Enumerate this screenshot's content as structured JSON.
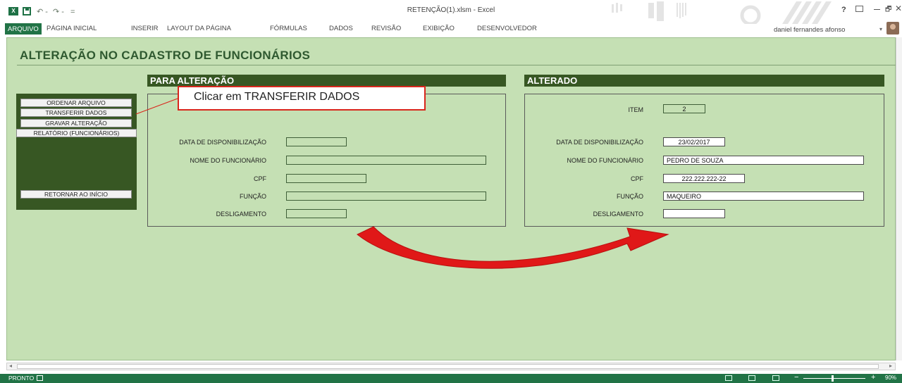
{
  "window": {
    "title": "RETENÇÃO(1).xlsm - Excel",
    "app_icon": "excel-logo-icon"
  },
  "quick_access": {
    "undo": "↶ -",
    "redo": "↷ -",
    "customize": "="
  },
  "ribbon": {
    "tabs": [
      {
        "label": "ARQUIVO"
      },
      {
        "label": "PÁGINA INICIAL"
      },
      {
        "label": "INSERIR"
      },
      {
        "label": "LAYOUT DA PÁGINA"
      },
      {
        "label": "FÓRMULAS"
      },
      {
        "label": "DADOS"
      },
      {
        "label": "REVISÃO"
      },
      {
        "label": "EXIBIÇÃO"
      },
      {
        "label": "DESENVOLVEDOR"
      }
    ],
    "user": "daniel fernandes afonso",
    "help": "?"
  },
  "sheet": {
    "title": "ALTERAÇÃO NO CADASTRO DE FUNCIONÁRIOS",
    "background": "#c5e0b4",
    "accent": "#375723",
    "buttons": {
      "ordenar": "ORDENAR ARQUIVO",
      "transferir": "TRANSFERIR DADOS",
      "gravar": "GRAVAR ALTERAÇÃO",
      "relatorio": "RELATÓRIO (FUNCIONÁRIOS)",
      "retornar": "RETORNAR AO INÍCIO"
    },
    "para_alteracao": {
      "header": "PARA ALTERAÇÃO",
      "labels": {
        "data": "DATA DE DISPONIBILIZAÇÃO",
        "nome": "NOME DO FUNCIONÁRIO",
        "cpf": "CPF",
        "funcao": "FUNÇÃO",
        "desligamento": "DESLIGAMENTO"
      }
    },
    "alterado": {
      "header": "ALTERADO",
      "labels": {
        "item": "ITEM",
        "data": "DATA DE DISPONIBILIZAÇÃO",
        "nome": "NOME DO FUNCIONÁRIO",
        "cpf": "CPF",
        "funcao": "FUNÇÃO",
        "desligamento": "DESLIGAMENTO"
      },
      "values": {
        "item": "2",
        "data": "23/02/2017",
        "nome": "PEDRO DE SOUZA",
        "cpf": "222.222.222-22",
        "funcao": "MAQUEIRO",
        "desligamento": ""
      }
    },
    "callout": "Clicar em TRANSFERIR DADOS",
    "callout_color": "#d9261c"
  },
  "status": {
    "text": "PRONTO",
    "zoom": "90%"
  }
}
